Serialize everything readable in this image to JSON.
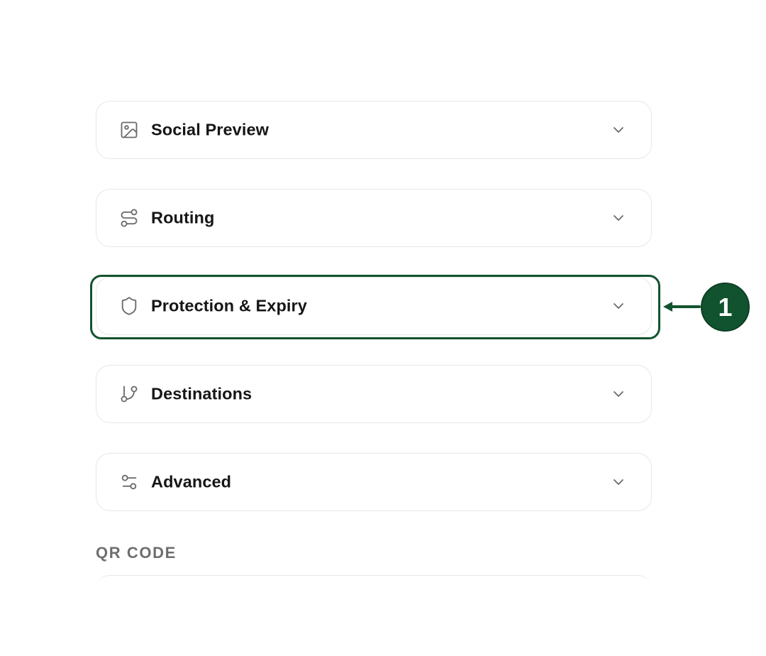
{
  "sections": [
    {
      "label": "Social Preview",
      "icon": "image-icon",
      "expanded": false
    },
    {
      "label": "Routing",
      "icon": "route-icon",
      "expanded": false
    },
    {
      "label": "Protection & Expiry",
      "icon": "shield-icon",
      "expanded": false
    },
    {
      "label": "Destinations",
      "icon": "git-branch-icon",
      "expanded": false
    },
    {
      "label": "Advanced",
      "icon": "sliders-icon",
      "expanded": false
    }
  ],
  "qr": {
    "heading": "QR CODE"
  },
  "callout": {
    "number": "1",
    "target": "Protection & Expiry",
    "color": "#12532f"
  },
  "colors": {
    "text": "#161616",
    "icon": "#6b6b6b",
    "border": "#e7e7e7",
    "muted_heading": "#6e6e6e",
    "accent": "#12532f"
  }
}
